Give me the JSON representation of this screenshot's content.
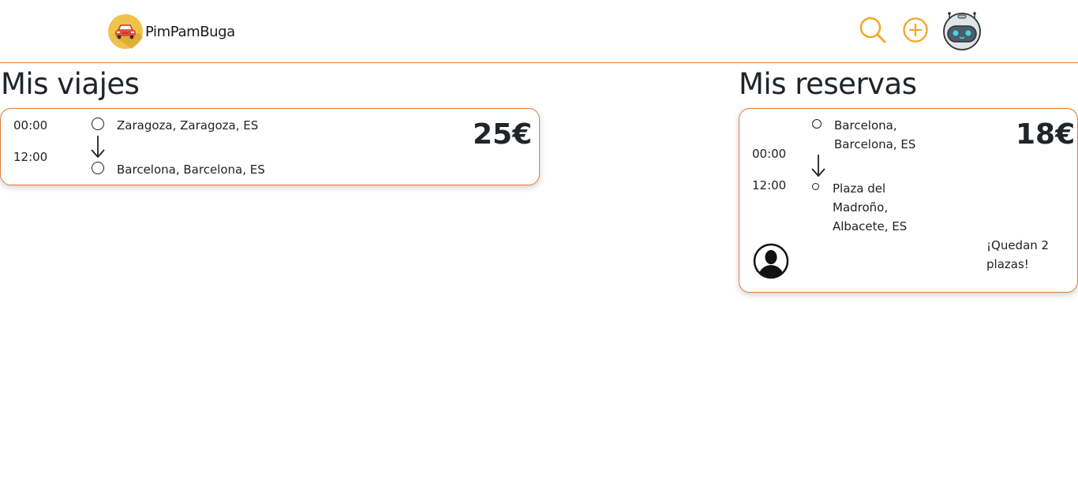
{
  "header": {
    "brand_name": "PimPamBuga",
    "icons": {
      "logo": "car-logo-icon",
      "search": "search-icon",
      "add": "plus-circle-icon",
      "avatar": "robot-avatar-icon"
    }
  },
  "trips": {
    "title": "Mis viajes",
    "items": [
      {
        "departure_time": "00:00",
        "arrival_time": "12:00",
        "origin": "Zaragoza, Zaragoza, ES",
        "destination": "Barcelona, Barcelona, ES",
        "price": "25€"
      }
    ]
  },
  "reservations": {
    "title": "Mis reservas",
    "items": [
      {
        "departure_time": "00:00",
        "arrival_time": "12:00",
        "origin": "Barcelona, Barcelona, ES",
        "destination": "Plaza del Madroño, Albacete, ES",
        "price": "18€",
        "seats_left": "¡Quedan 2 plazas!"
      }
    ]
  },
  "colors": {
    "accent": "#f5a623",
    "border": "#e07b39",
    "text": "#212529"
  }
}
